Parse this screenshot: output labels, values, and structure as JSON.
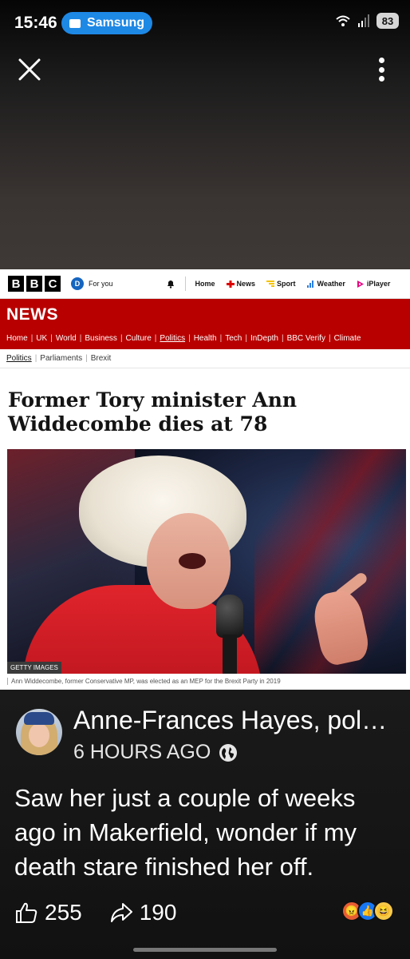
{
  "status_bar": {
    "time": "15:46",
    "cast_label": "Samsung",
    "battery": "83",
    "icons": [
      "wifi-icon",
      "signal-icon",
      "battery-icon"
    ]
  },
  "viewer": {
    "close_icon": "close-icon",
    "more_icon": "more-vertical-icon"
  },
  "bbc": {
    "logo_letters": [
      "B",
      "B",
      "C"
    ],
    "for_you_badge": "D",
    "for_you_label": "For you",
    "nav": [
      "Home",
      "News",
      "Sport",
      "Weather",
      "iPlayer"
    ],
    "section_title": "NEWS",
    "news_nav": [
      "Home",
      "UK",
      "World",
      "Business",
      "Culture",
      "Politics",
      "Health",
      "Tech",
      "InDepth",
      "BBC Verify",
      "Climate"
    ],
    "news_nav_active": "Politics",
    "sub_nav": [
      "Politics",
      "Parliaments",
      "Brexit"
    ],
    "headline": "Former Tory minister Ann Widdecombe dies at 78",
    "photo_credit": "GETTY IMAGES",
    "caption": "Ann Widdecombe, former Conservative MP, was elected as an MEP for the Brexit Party in 2019",
    "colors": {
      "news_red": "#b80000",
      "foryou_blue": "#1565c0"
    }
  },
  "post": {
    "author": "Anne-Frances Hayes, pol…",
    "time": "6 HOURS AGO",
    "text": "Saw her just a couple of weeks ago in Makerfield, wonder if my death stare finished her off.",
    "likes": "255",
    "shares": "190",
    "reactions": [
      "angry-reaction-icon",
      "like-reaction-icon",
      "haha-reaction-icon"
    ]
  }
}
